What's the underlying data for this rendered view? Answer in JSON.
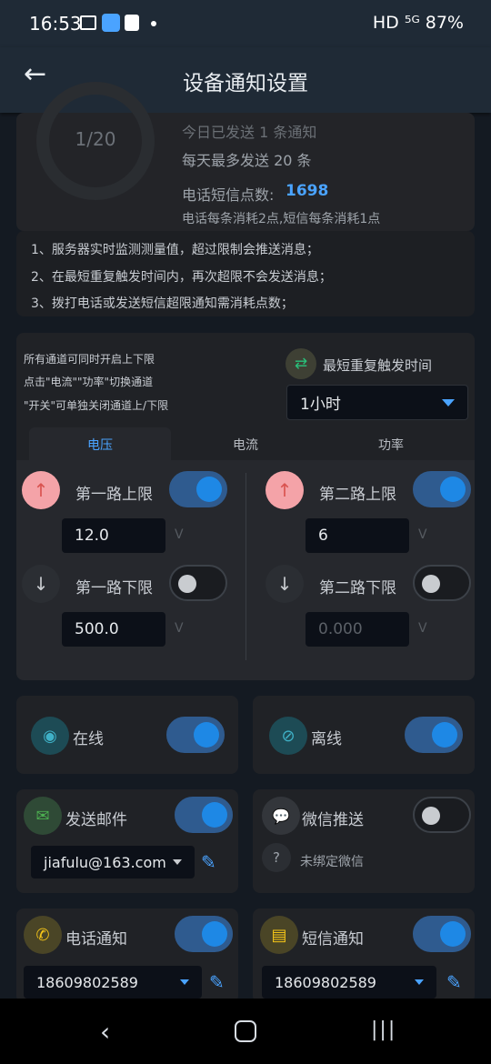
{
  "status": {
    "time": "16:53",
    "right": "HD ⁵ᴳ 87%"
  },
  "header": {
    "title": "设备通知设置"
  },
  "summary": {
    "ring_text": "1/20",
    "sent_today": "今日已发送 1 条通知",
    "max_per_day": "每天最多发送 20 条",
    "points_label": "电话短信点数:",
    "points_value": "1698",
    "cost_note": "电话每条消耗2点,短信每条消耗1点"
  },
  "notes": [
    "1、服务器实时监测测量值，超过限制会推送消息；",
    "2、在最短重复触发时间内，再次超限不会发送消息；",
    "3、拨打电话或发送短信超限通知需消耗点数；"
  ],
  "channel_help": [
    "所有通道可同时开启上下限",
    "点击\"电流\"\"功率\"切换通道",
    "\"开关\"可单独关闭通道上/下限"
  ],
  "repeat": {
    "label": "最短重复触发时间",
    "value": "1小时"
  },
  "tabs": [
    "电压",
    "电流",
    "功率"
  ],
  "limits": {
    "ch1_upper_label": "第一路上限",
    "ch1_upper_value": "12.0",
    "ch1_lower_label": "第一路下限",
    "ch1_lower_value": "500.0",
    "ch2_upper_label": "第二路上限",
    "ch2_upper_value": "6",
    "ch2_lower_label": "第二路下限",
    "ch2_lower_placeholder": "0.000",
    "unit": "V"
  },
  "online": {
    "label": "在线"
  },
  "offline": {
    "label": "离线"
  },
  "email": {
    "label": "发送邮件",
    "value": "jiafulu@163.com"
  },
  "wechat": {
    "label": "微信推送",
    "status": "未绑定微信"
  },
  "phone": {
    "label": "电话通知",
    "value": "18609802589"
  },
  "sms": {
    "label": "短信通知",
    "value": "18609802589"
  }
}
